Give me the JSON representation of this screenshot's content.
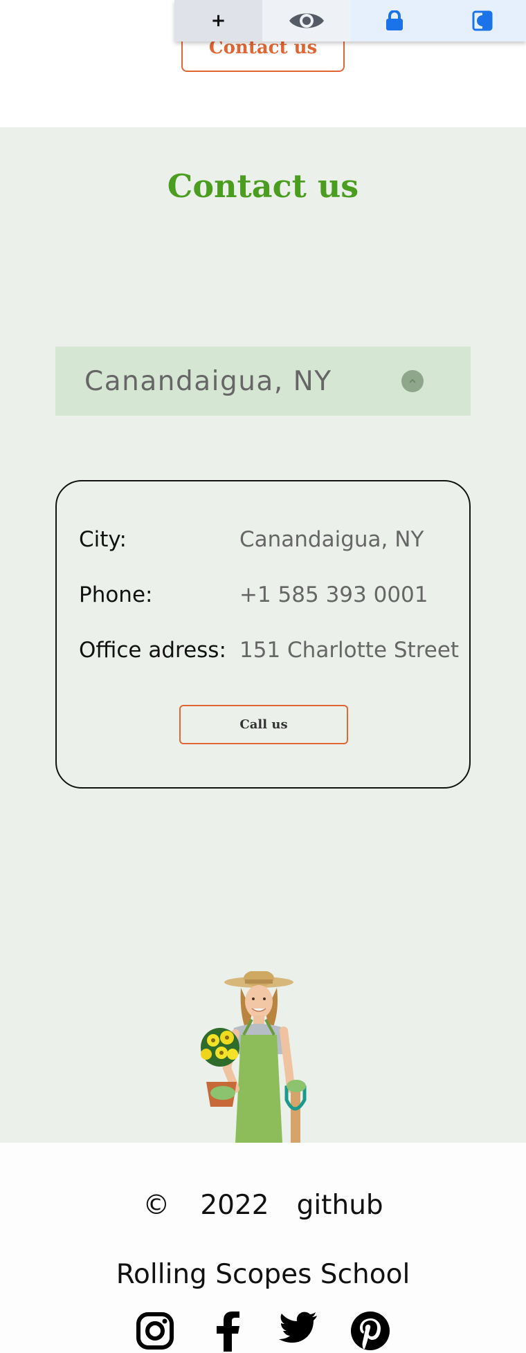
{
  "toolbar": {
    "items": [
      {
        "icon": "plus-icon",
        "label": "+"
      },
      {
        "icon": "eye-icon"
      },
      {
        "icon": "lock-icon"
      },
      {
        "icon": "contrast-icon"
      }
    ]
  },
  "top_button": {
    "label": "Contact us"
  },
  "contact": {
    "title": "Contact us",
    "select": {
      "value": "Canandaigua, NY",
      "icon": "chevron-up-icon"
    },
    "card": {
      "rows": [
        {
          "key": "City:",
          "value": "Canandaigua, NY"
        },
        {
          "key": "Phone:",
          "value": "+1 585 393 0001"
        },
        {
          "key": "Office adress:",
          "value": "151 Charlotte Street"
        }
      ],
      "call_label": "Call us"
    }
  },
  "footer": {
    "copyright": "©",
    "year": "2022",
    "github": "github",
    "school": "Rolling Scopes School",
    "socials": [
      "instagram-icon",
      "facebook-icon",
      "twitter-icon",
      "pinterest-icon"
    ]
  },
  "colors": {
    "accent_green": "#4a9d1f",
    "accent_orange": "#e06733",
    "section_bg": "#ebf0eb",
    "select_bg": "#d5e6d3"
  }
}
